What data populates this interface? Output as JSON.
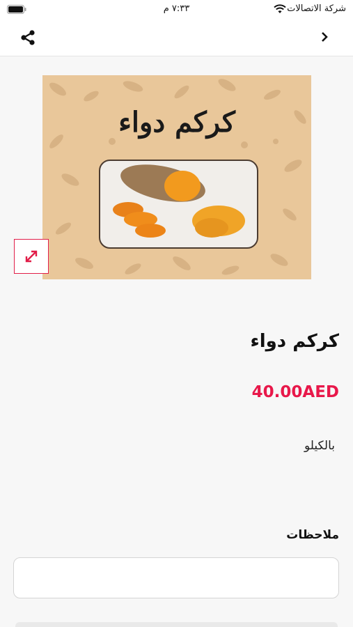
{
  "status_bar": {
    "carrier": "شركة الاتصالات",
    "time": "٧:٣٣ م"
  },
  "nav": {
    "back_icon": "chevron-right-icon",
    "share_icon": "share-icon"
  },
  "product": {
    "image_title": "كركم دواء",
    "name": "كركم دواء",
    "price": "40.00AED",
    "unit": "بالكيلو",
    "expand_icon": "expand-icon"
  },
  "notes": {
    "label": "ملاحظات",
    "value": ""
  },
  "colors": {
    "accent": "#e8184a",
    "image_background": "#e9c79a",
    "turmeric": "#f29a1e"
  }
}
